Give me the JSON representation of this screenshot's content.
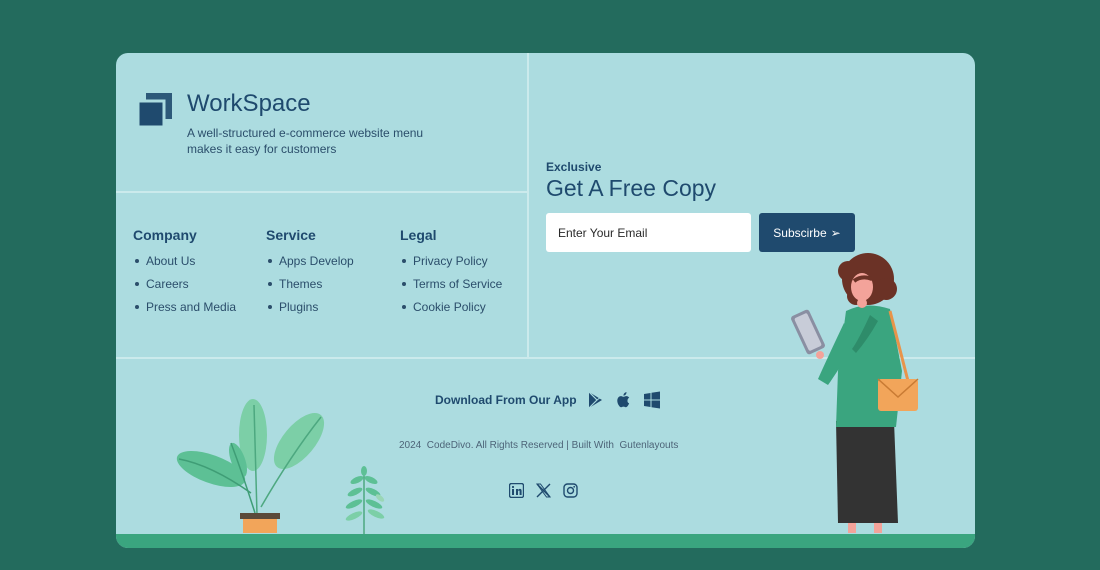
{
  "brand": {
    "name": "WorkSpace",
    "tagline": "A well-structured e-commerce website menu makes it easy for customers"
  },
  "columns": [
    {
      "title": "Company",
      "items": [
        "About Us",
        "Careers",
        "Press and Media"
      ]
    },
    {
      "title": "Service",
      "items": [
        "Apps Develop",
        "Themes",
        "Plugins"
      ]
    },
    {
      "title": "Legal",
      "items": [
        "Privacy Policy",
        "Terms of Service",
        "Cookie Policy"
      ]
    }
  ],
  "newsletter": {
    "eyebrow": "Exclusive",
    "title": "Get A Free Copy",
    "email_placeholder": "Enter Your Email",
    "button_label": "Subscirbe",
    "button_arrow": "➢"
  },
  "apps": {
    "label": "Download From Our App",
    "icons": [
      "google-play-icon",
      "apple-icon",
      "windows-icon"
    ]
  },
  "copyright": "2024  CodeDivo. All Rights Reserved | Built With  Gutenlayouts",
  "social": [
    "linkedin-icon",
    "x-icon",
    "instagram-icon"
  ],
  "colors": {
    "page_bg": "#236b5d",
    "card_bg": "#acdce0",
    "primary": "#1f4a6e",
    "ground": "#3aa57f"
  }
}
